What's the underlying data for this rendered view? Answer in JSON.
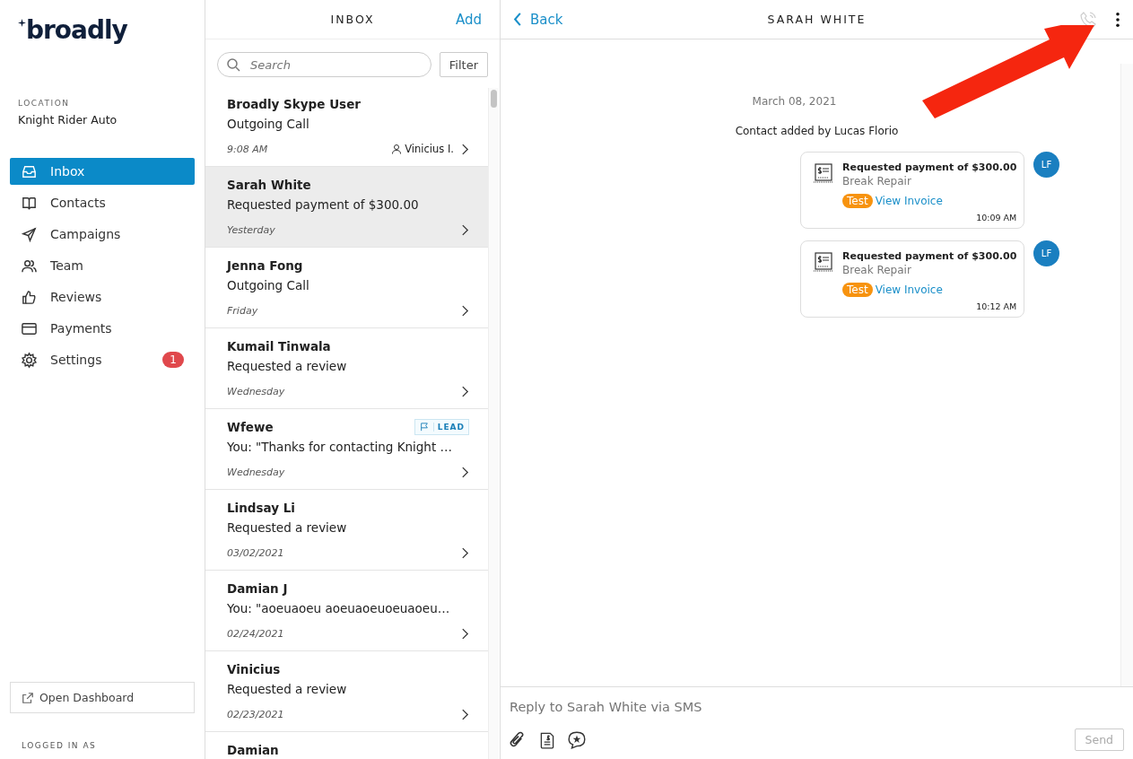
{
  "sidebar": {
    "logo": "broadly",
    "location_label": "LOCATION",
    "location": "Knight Rider Auto",
    "items": [
      {
        "label": "Inbox",
        "selected": true
      },
      {
        "label": "Contacts",
        "selected": false
      },
      {
        "label": "Campaigns",
        "selected": false
      },
      {
        "label": "Team",
        "selected": false
      },
      {
        "label": "Reviews",
        "selected": false
      },
      {
        "label": "Payments",
        "selected": false
      },
      {
        "label": "Settings",
        "selected": false,
        "badge": "1"
      }
    ],
    "open_dashboard": "Open Dashboard",
    "logged_in_label": "LOGGED IN AS"
  },
  "inbox": {
    "title": "INBOX",
    "add": "Add",
    "search": {
      "placeholder": "Search"
    },
    "filter": "Filter",
    "conversations": [
      {
        "name": "Broadly Skype User",
        "preview": "Outgoing Call",
        "time": "9:08 AM",
        "agent": "Vinicius I.",
        "selected": false
      },
      {
        "name": "Sarah White",
        "preview": "Requested payment of $300.00",
        "time": "Yesterday",
        "selected": true
      },
      {
        "name": "Jenna Fong",
        "preview": "Outgoing Call",
        "time": "Friday",
        "selected": false
      },
      {
        "name": "Kumail Tinwala",
        "preview": "Requested a review",
        "time": "Wednesday",
        "selected": false
      },
      {
        "name": "Wfewe",
        "preview": "You: \"Thanks for contacting Knight …",
        "time": "Wednesday",
        "tag": "LEAD",
        "selected": false
      },
      {
        "name": "Lindsay Li",
        "preview": "Requested a review",
        "time": "03/02/2021",
        "selected": false
      },
      {
        "name": "Damian J",
        "preview": "You: \"aoeuaoeu aoeuaoeuoeuaoeu…",
        "time": "02/24/2021",
        "selected": false
      },
      {
        "name": "Vinicius",
        "preview": "Requested a review",
        "time": "02/23/2021",
        "selected": false
      },
      {
        "name": "Damian",
        "selected": false
      }
    ]
  },
  "conversation": {
    "back": "Back",
    "title": "SARAH WHITE",
    "date": "March 08, 2021",
    "event": "Contact added by Lucas Florio",
    "messages": [
      {
        "title": "Requested payment of $300.00",
        "subtitle": "Break Repair",
        "tag": "Test",
        "link": "View Invoice",
        "time": "10:09 AM",
        "avatar": "LF"
      },
      {
        "title": "Requested payment of $300.00",
        "subtitle": "Break Repair",
        "tag": "Test",
        "link": "View Invoice",
        "time": "10:12 AM",
        "avatar": "LF"
      }
    ],
    "reply": {
      "placeholder": "Reply to Sarah White via SMS"
    },
    "send": "Send"
  }
}
